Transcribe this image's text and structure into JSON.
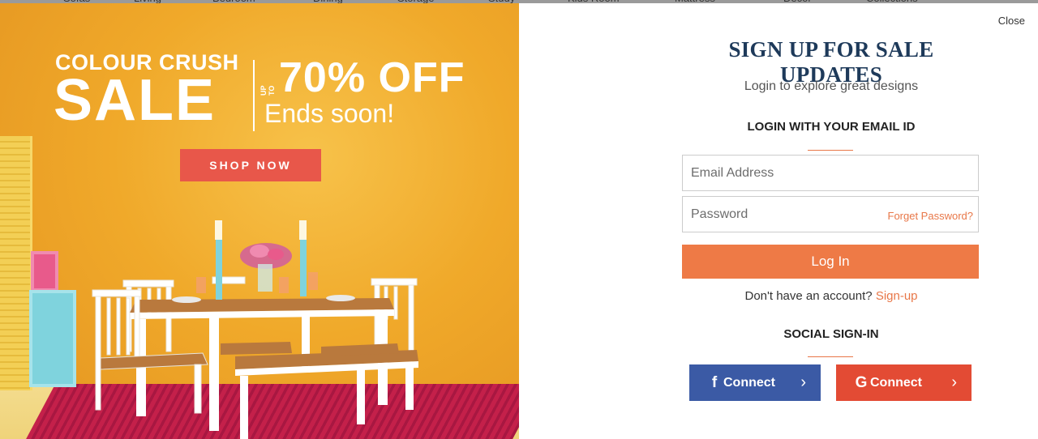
{
  "background_nav": {
    "items": [
      "Sofas",
      "Living",
      "Bedroom",
      "Dining",
      "Storage",
      "Study",
      "Kids Room",
      "Mattress",
      "Decor",
      "Collections"
    ]
  },
  "promo": {
    "line1": "COLOUR CRUSH",
    "line2": "SALE",
    "upto": "UP TO",
    "offer": "70% OFF",
    "ends": "Ends soon!",
    "shop_button": "SHOP NOW"
  },
  "form": {
    "close_label": "Close",
    "headline": "SIGN UP FOR SALE UPDATES",
    "subtitle": "Login to explore great designs",
    "email_section": "LOGIN WITH YOUR EMAIL ID",
    "email_placeholder": "Email Address",
    "password_placeholder": "Password",
    "forgot_password": "Forget Password?",
    "login_button": "Log In",
    "account_prompt": "Don't have an account?",
    "signup_link": "Sign-up",
    "social_section": "SOCIAL SIGN-IN",
    "facebook_button": "Connect",
    "google_button": "Connect"
  },
  "icons": {
    "facebook": "facebook-icon",
    "google": "google-icon",
    "chevron": "chevron-right-icon"
  },
  "colors": {
    "accent": "#ee7a46",
    "facebook": "#3b5aa5",
    "google": "#e34b34",
    "promo_bg": "#f0a92a",
    "shop_button": "#e8574a",
    "headline": "#1e3a5a"
  }
}
